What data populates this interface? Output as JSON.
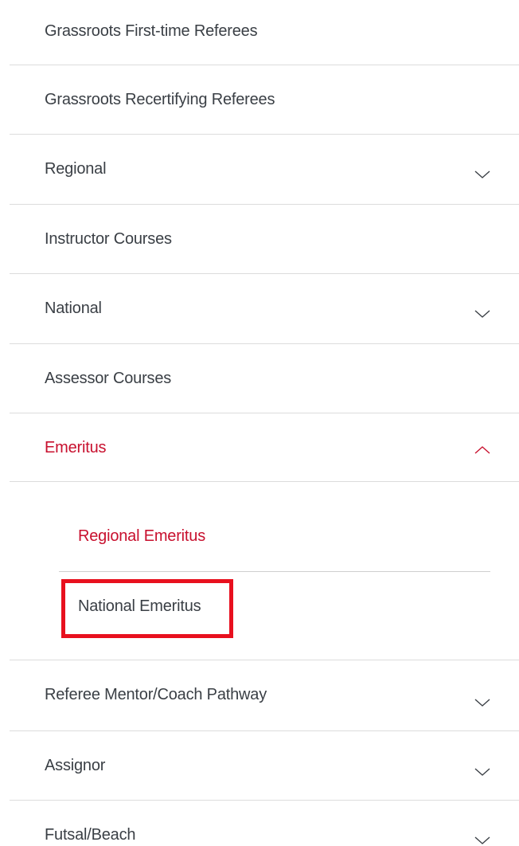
{
  "menu": {
    "items": [
      {
        "label": "Grassroots First-time Referees",
        "has_chevron": false
      },
      {
        "label": "Grassroots Recertifying Referees",
        "has_chevron": false
      },
      {
        "label": "Regional",
        "has_chevron": true,
        "icon": "chevron-down-icon"
      },
      {
        "label": "Instructor Courses",
        "has_chevron": false
      },
      {
        "label": "National",
        "has_chevron": true,
        "icon": "chevron-down-icon"
      },
      {
        "label": "Assessor Courses",
        "has_chevron": false
      },
      {
        "label": "Emeritus",
        "has_chevron": true,
        "icon": "chevron-up-icon",
        "expanded": true,
        "active": true
      },
      {
        "label": "Referee Mentor/Coach Pathway",
        "has_chevron": true,
        "icon": "chevron-down-icon"
      },
      {
        "label": "Assignor",
        "has_chevron": true,
        "icon": "chevron-down-icon"
      },
      {
        "label": "Futsal/Beach",
        "has_chevron": true,
        "icon": "chevron-down-icon"
      }
    ],
    "emeritus_sub": [
      {
        "label": "Regional Emeritus",
        "active": true
      },
      {
        "label": "National Emeritus",
        "highlighted": true
      }
    ]
  },
  "colors": {
    "text": "#3a3f45",
    "accent": "#c8102e",
    "divider": "#dcdcdc",
    "highlight_border": "#e8101e"
  }
}
